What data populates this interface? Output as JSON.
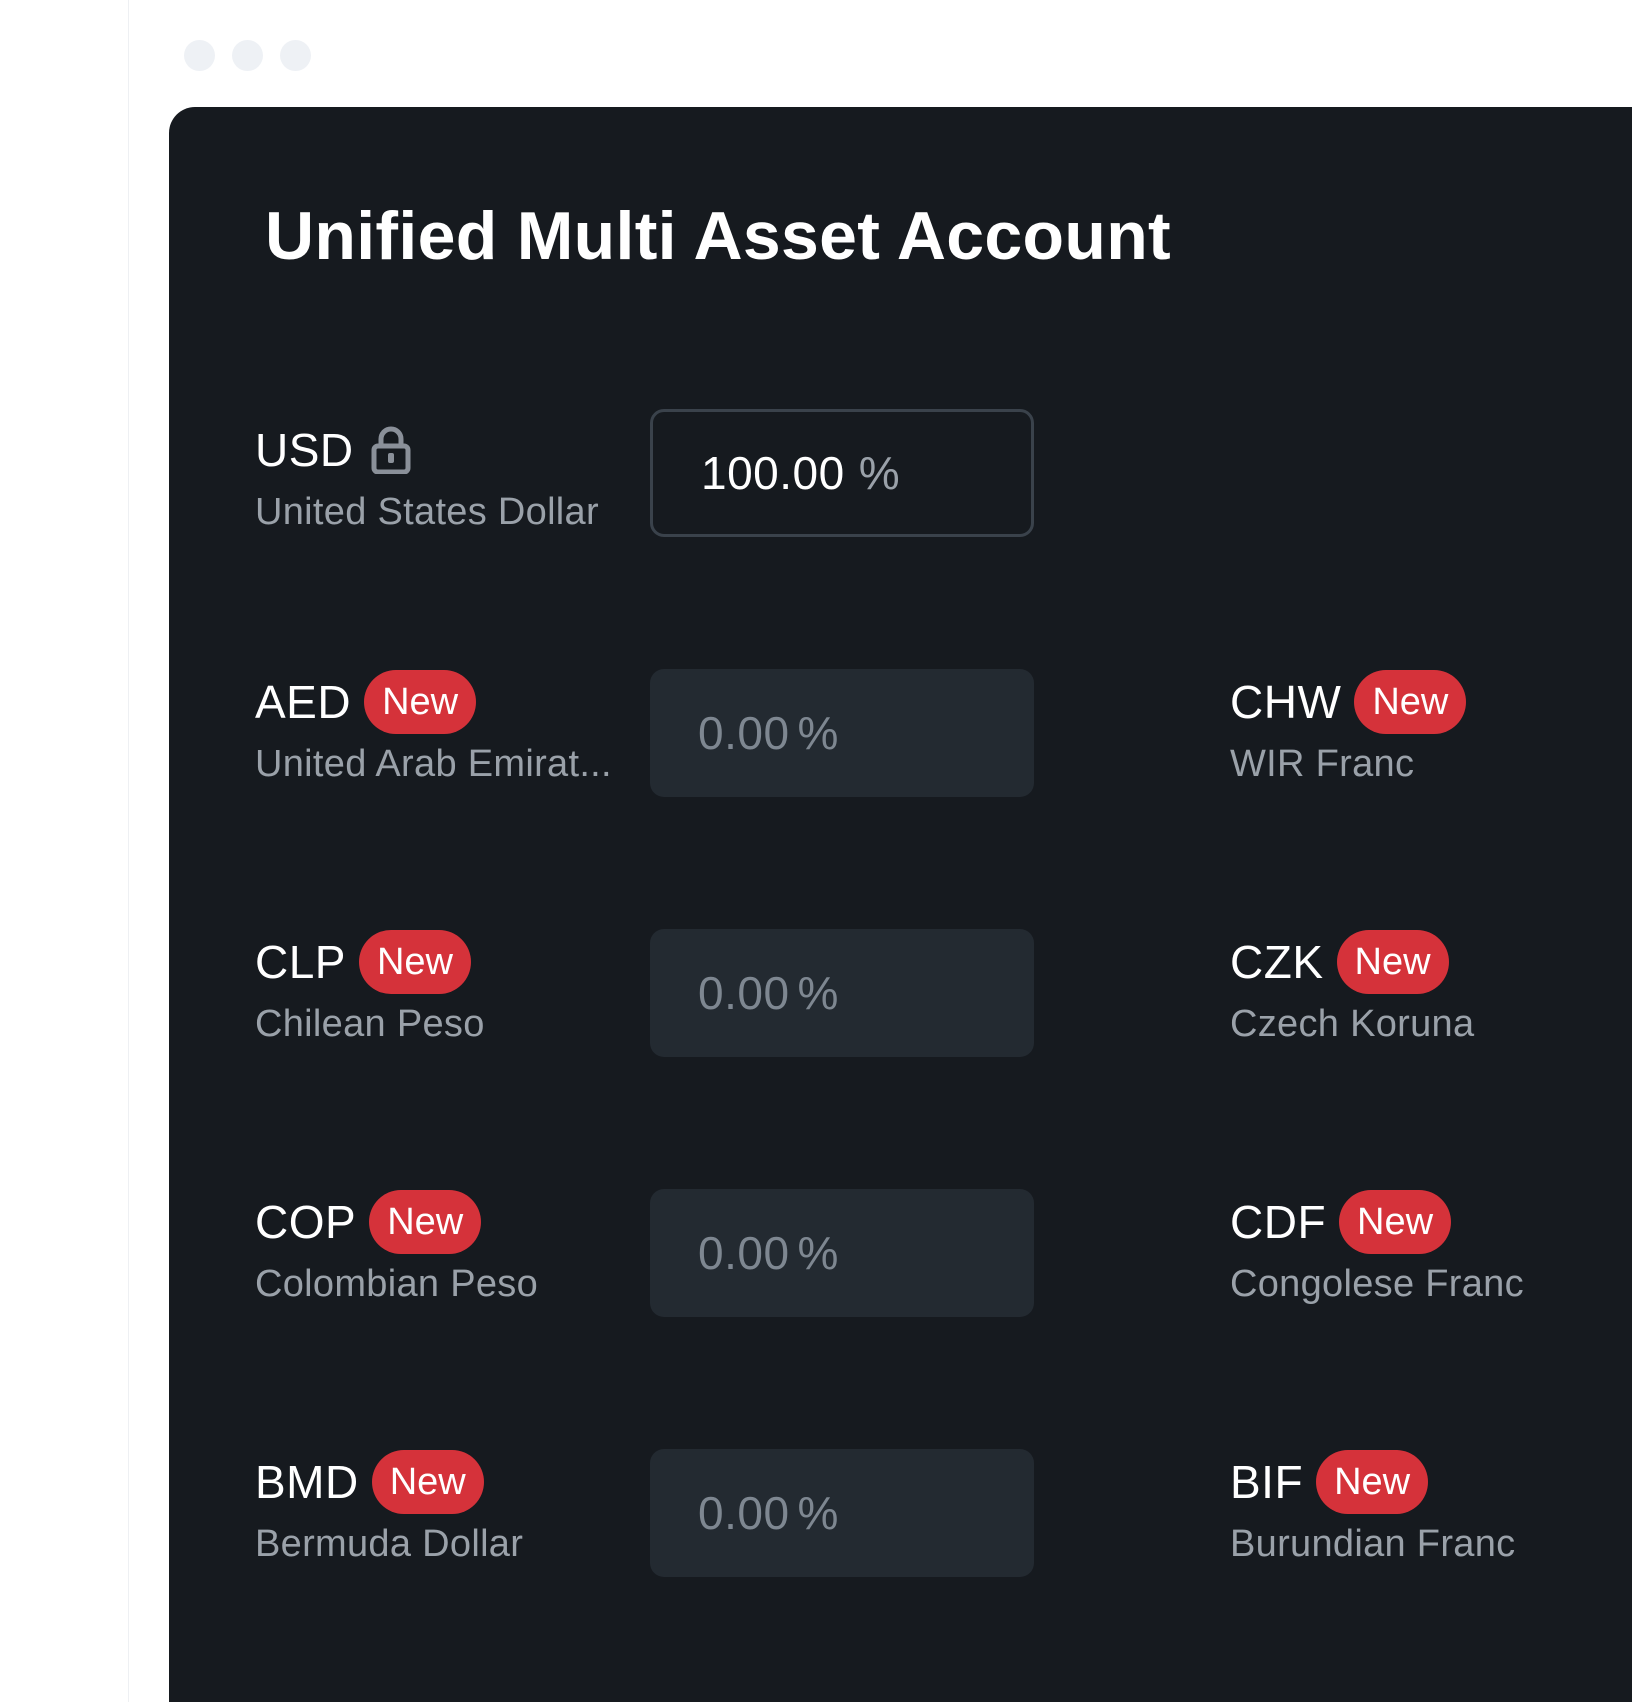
{
  "app": {
    "title": "Unified Multi Asset Account"
  },
  "colors": {
    "panel_bg": "#161a1f",
    "input_bg": "#232a31",
    "badge": "#d5323a",
    "muted_text": "#9aa1a9"
  },
  "primary": {
    "code": "USD",
    "icon": "lock-icon",
    "name": "United States Dollar",
    "value": "100.00",
    "unit": "%"
  },
  "assets_left": [
    {
      "code": "AED",
      "badge": "New",
      "name": "United Arab Emirat...",
      "value": "0.00",
      "unit": "%"
    },
    {
      "code": "CLP",
      "badge": "New",
      "name": "Chilean Peso",
      "value": "0.00",
      "unit": "%"
    },
    {
      "code": "COP",
      "badge": "New",
      "name": "Colombian Peso",
      "value": "0.00",
      "unit": "%"
    },
    {
      "code": "BMD",
      "badge": "New",
      "name": "Bermuda Dollar",
      "value": "0.00",
      "unit": "%"
    }
  ],
  "assets_right": [
    {
      "code": "CHW",
      "badge": "New",
      "name": "WIR Franc"
    },
    {
      "code": "CZK",
      "badge": "New",
      "name": "Czech Koruna"
    },
    {
      "code": "CDF",
      "badge": "New",
      "name": "Congolese Franc"
    },
    {
      "code": "BIF",
      "badge": "New",
      "name": "Burundian Franc"
    }
  ]
}
